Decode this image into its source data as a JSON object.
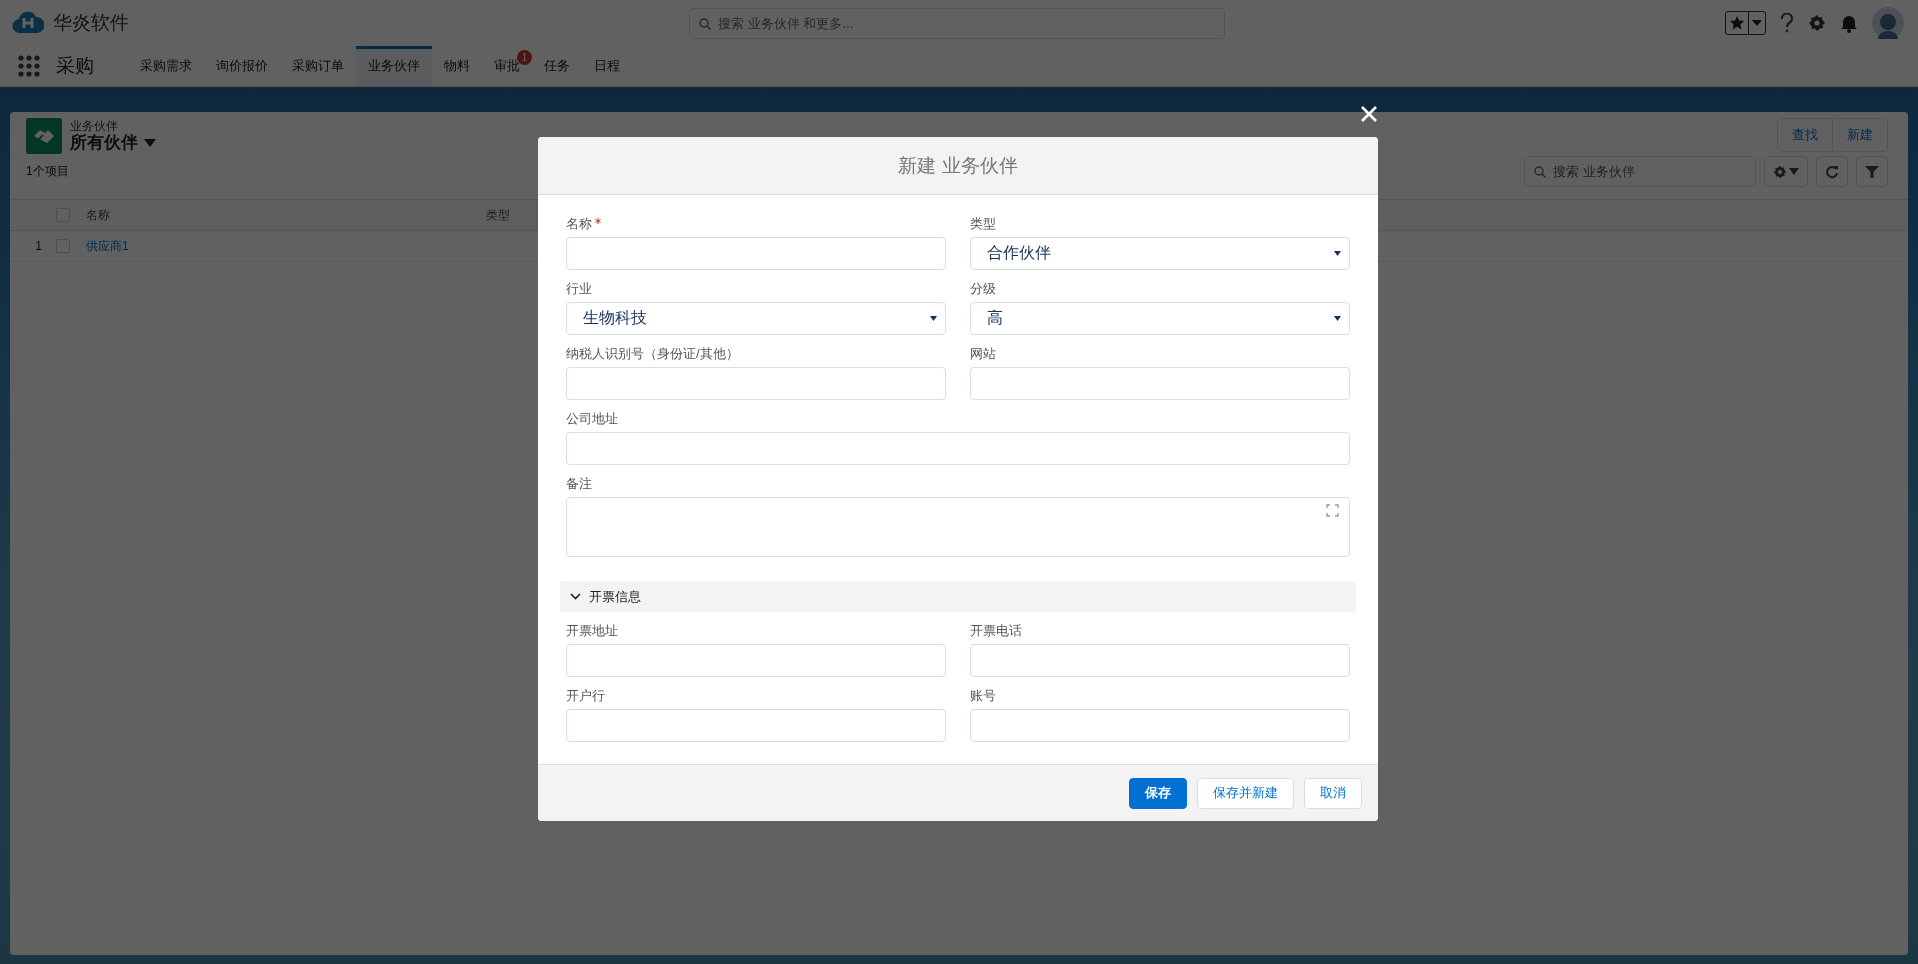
{
  "app": {
    "title": "华炎软件",
    "search_placeholder": "搜索 业务伙伴 和更多..."
  },
  "nav": {
    "app_name": "采购",
    "tabs": [
      {
        "label": "采购需求",
        "selected": false
      },
      {
        "label": "询价报价",
        "selected": false
      },
      {
        "label": "采购订单",
        "selected": false
      },
      {
        "label": "业务伙伴",
        "selected": true
      },
      {
        "label": "物料",
        "selected": false
      },
      {
        "label": "审批",
        "selected": false,
        "badge": "1"
      },
      {
        "label": "任务",
        "selected": false
      },
      {
        "label": "日程",
        "selected": false
      }
    ]
  },
  "list": {
    "object": "业务伙伴",
    "view": "所有伙伴",
    "count": "1个项目",
    "buttons": [
      "查找",
      "新建"
    ],
    "search_placeholder": "搜索 业务伙伴",
    "all_checked": false,
    "columns": [
      "名称",
      "类型"
    ],
    "rows": [
      {
        "number": "1",
        "name": "供应商1",
        "checked": false
      }
    ]
  },
  "modal": {
    "title": "新建 业务伙伴",
    "fields": [
      {
        "label": "名称",
        "kind": "text",
        "required": true,
        "full_width": false
      },
      {
        "label": "类型",
        "kind": "select",
        "value": "合作伙伴",
        "required": false,
        "full_width": false
      },
      {
        "label": "行业",
        "kind": "select",
        "value": "生物科技",
        "required": false,
        "full_width": false
      },
      {
        "label": "分级",
        "kind": "select",
        "value": "高",
        "required": false,
        "full_width": false
      },
      {
        "label": "纳税人识别号（身份证/其他）",
        "kind": "text",
        "required": false,
        "full_width": false
      },
      {
        "label": "网站",
        "kind": "text",
        "required": false,
        "full_width": false
      },
      {
        "label": "公司地址",
        "kind": "text",
        "required": false,
        "full_width": true
      },
      {
        "label": "备注",
        "kind": "textarea",
        "required": false,
        "full_width": true
      }
    ],
    "sections": [
      {
        "title": "开票信息",
        "expanded": true,
        "fields": [
          {
            "label": "开票地址",
            "kind": "text",
            "required": false,
            "full_width": false
          },
          {
            "label": "开票电话",
            "kind": "text",
            "required": false,
            "full_width": false
          },
          {
            "label": "开户行",
            "kind": "text",
            "required": false,
            "full_width": false
          },
          {
            "label": "账号",
            "kind": "text",
            "required": false,
            "full_width": false
          }
        ]
      }
    ],
    "buttons": [
      {
        "label": "保存",
        "primary": true
      },
      {
        "label": "保存并新建",
        "primary": false
      },
      {
        "label": "取消",
        "primary": false
      }
    ]
  }
}
